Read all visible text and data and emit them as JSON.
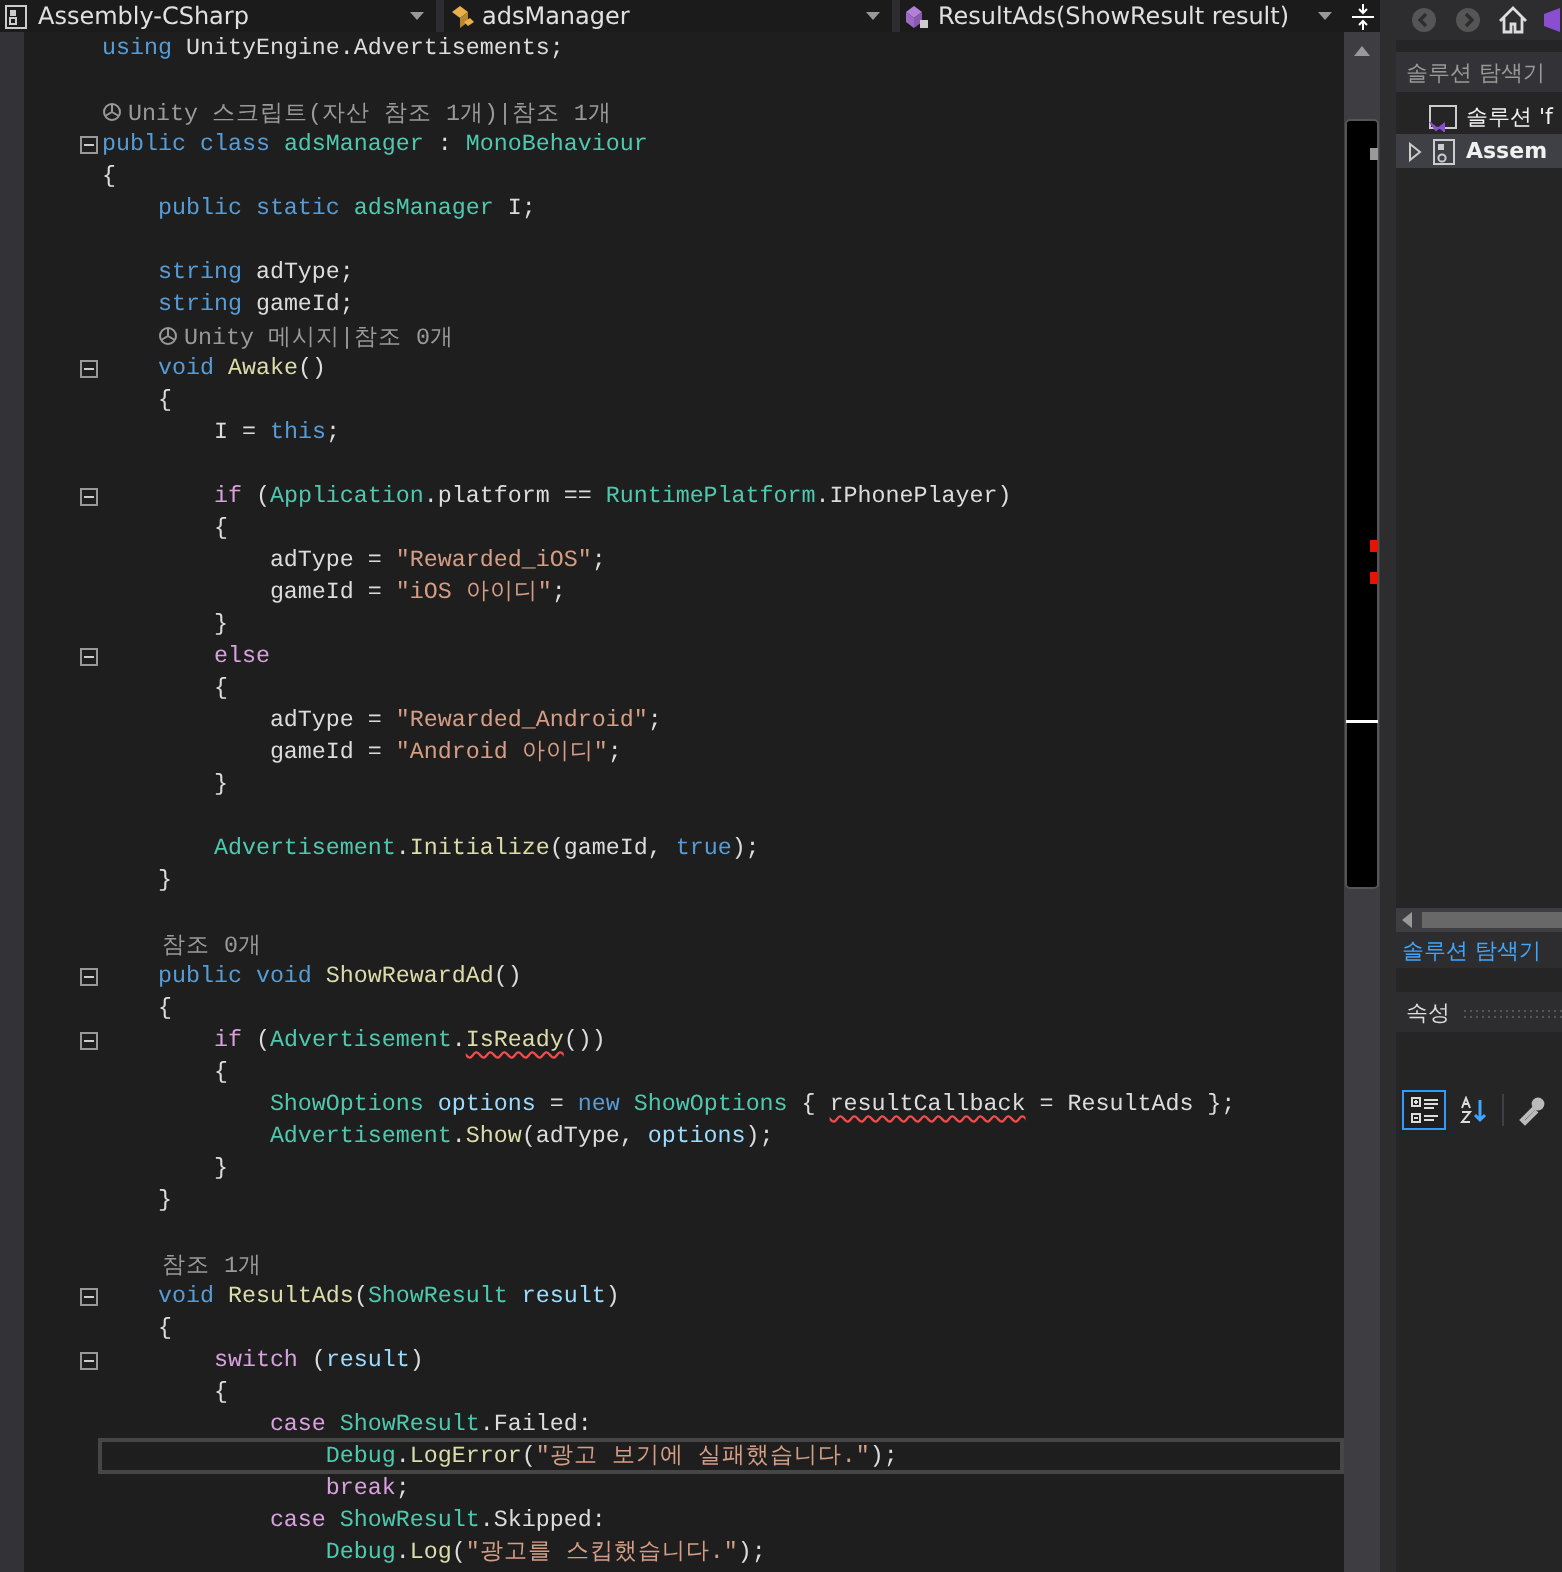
{
  "navigation_bar": {
    "dropdowns": [
      {
        "label": "Assembly-CSharp"
      },
      {
        "label": "adsManager"
      },
      {
        "label": "ResultAds(ShowResult result)"
      }
    ]
  },
  "editor": {
    "lines": [
      {
        "kind": "code",
        "fold": false,
        "current": false,
        "tokens": [
          {
            "text": "using",
            "kind": "kw"
          },
          {
            "text": " UnityEngine.Advertisements;",
            "kind": "plain"
          }
        ]
      },
      {
        "kind": "blank",
        "fold": false,
        "current": false
      },
      {
        "kind": "unitylens",
        "text": "Unity 스크립트(자산 참조 1개)|참조 1개",
        "fold": false,
        "current": false
      },
      {
        "kind": "code",
        "fold": true,
        "current": false,
        "tokens": [
          {
            "text": "public class ",
            "kind": "kw"
          },
          {
            "text": "adsManager",
            "kind": "type"
          },
          {
            "text": " : ",
            "kind": "plain"
          },
          {
            "text": "MonoBehaviour",
            "kind": "type"
          }
        ]
      },
      {
        "kind": "code",
        "fold": false,
        "current": false,
        "tokens": [
          {
            "text": "{",
            "kind": "plain"
          }
        ]
      },
      {
        "kind": "code",
        "fold": false,
        "current": false,
        "tokens": [
          {
            "text": "    public static ",
            "kind": "kw"
          },
          {
            "text": "adsManager",
            "kind": "type"
          },
          {
            "text": " I;",
            "kind": "plain"
          }
        ]
      },
      {
        "kind": "blank",
        "fold": false,
        "current": false
      },
      {
        "kind": "code",
        "fold": false,
        "current": false,
        "tokens": [
          {
            "text": "    string",
            "kind": "kw"
          },
          {
            "text": " adType;",
            "kind": "plain"
          }
        ]
      },
      {
        "kind": "code",
        "fold": false,
        "current": false,
        "tokens": [
          {
            "text": "    string",
            "kind": "kw"
          },
          {
            "text": " gameId;",
            "kind": "plain"
          }
        ]
      },
      {
        "kind": "unitylens",
        "text": "    Unity 메시지|참조 0개",
        "fold": false,
        "current": false
      },
      {
        "kind": "code",
        "fold": true,
        "current": false,
        "tokens": [
          {
            "text": "    void ",
            "kind": "kw"
          },
          {
            "text": "Awake",
            "kind": "method"
          },
          {
            "text": "()",
            "kind": "plain"
          }
        ]
      },
      {
        "kind": "code",
        "fold": false,
        "current": false,
        "tokens": [
          {
            "text": "    {",
            "kind": "plain"
          }
        ]
      },
      {
        "kind": "code",
        "fold": false,
        "current": false,
        "tokens": [
          {
            "text": "        I = ",
            "kind": "plain"
          },
          {
            "text": "this",
            "kind": "kw"
          },
          {
            "text": ";",
            "kind": "plain"
          }
        ]
      },
      {
        "kind": "blank",
        "fold": false,
        "current": false
      },
      {
        "kind": "code",
        "fold": true,
        "current": false,
        "tokens": [
          {
            "text": "        if",
            "kind": "ctl"
          },
          {
            "text": " (",
            "kind": "plain"
          },
          {
            "text": "Application",
            "kind": "type"
          },
          {
            "text": ".platform == ",
            "kind": "plain"
          },
          {
            "text": "RuntimePlatform",
            "kind": "type"
          },
          {
            "text": ".IPhonePlayer)",
            "kind": "plain"
          }
        ]
      },
      {
        "kind": "code",
        "fold": false,
        "current": false,
        "tokens": [
          {
            "text": "        {",
            "kind": "plain"
          }
        ]
      },
      {
        "kind": "code",
        "fold": false,
        "current": false,
        "tokens": [
          {
            "text": "            adType = ",
            "kind": "plain"
          },
          {
            "text": "\"Rewarded_iOS\"",
            "kind": "str"
          },
          {
            "text": ";",
            "kind": "plain"
          }
        ]
      },
      {
        "kind": "code",
        "fold": false,
        "current": false,
        "tokens": [
          {
            "text": "            gameId = ",
            "kind": "plain"
          },
          {
            "text": "\"iOS 아이디\"",
            "kind": "str"
          },
          {
            "text": ";",
            "kind": "plain"
          }
        ]
      },
      {
        "kind": "code",
        "fold": false,
        "current": false,
        "tokens": [
          {
            "text": "        }",
            "kind": "plain"
          }
        ]
      },
      {
        "kind": "code",
        "fold": true,
        "current": false,
        "tokens": [
          {
            "text": "        else",
            "kind": "ctl"
          }
        ]
      },
      {
        "kind": "code",
        "fold": false,
        "current": false,
        "tokens": [
          {
            "text": "        {",
            "kind": "plain"
          }
        ]
      },
      {
        "kind": "code",
        "fold": false,
        "current": false,
        "tokens": [
          {
            "text": "            adType = ",
            "kind": "plain"
          },
          {
            "text": "\"Rewarded_Android\"",
            "kind": "str"
          },
          {
            "text": ";",
            "kind": "plain"
          }
        ]
      },
      {
        "kind": "code",
        "fold": false,
        "current": false,
        "tokens": [
          {
            "text": "            gameId = ",
            "kind": "plain"
          },
          {
            "text": "\"Android 아이디\"",
            "kind": "str"
          },
          {
            "text": ";",
            "kind": "plain"
          }
        ]
      },
      {
        "kind": "code",
        "fold": false,
        "current": false,
        "tokens": [
          {
            "text": "        }",
            "kind": "plain"
          }
        ]
      },
      {
        "kind": "blank",
        "fold": false,
        "current": false
      },
      {
        "kind": "code",
        "fold": false,
        "current": false,
        "tokens": [
          {
            "text": "        Advertisement",
            "kind": "type"
          },
          {
            "text": ".",
            "kind": "plain"
          },
          {
            "text": "Initialize",
            "kind": "method"
          },
          {
            "text": "(gameId, ",
            "kind": "plain"
          },
          {
            "text": "true",
            "kind": "kw"
          },
          {
            "text": ");",
            "kind": "plain"
          }
        ]
      },
      {
        "kind": "code",
        "fold": false,
        "current": false,
        "tokens": [
          {
            "text": "    }",
            "kind": "plain"
          }
        ]
      },
      {
        "kind": "blank",
        "fold": false,
        "current": false
      },
      {
        "kind": "lens",
        "text": "    참조 0개",
        "fold": false,
        "current": false
      },
      {
        "kind": "code",
        "fold": true,
        "current": false,
        "tokens": [
          {
            "text": "    public void ",
            "kind": "kw"
          },
          {
            "text": "ShowRewardAd",
            "kind": "method"
          },
          {
            "text": "()",
            "kind": "plain"
          }
        ]
      },
      {
        "kind": "code",
        "fold": false,
        "current": false,
        "tokens": [
          {
            "text": "    {",
            "kind": "plain"
          }
        ]
      },
      {
        "kind": "code",
        "fold": true,
        "current": false,
        "tokens": [
          {
            "text": "        if",
            "kind": "ctl"
          },
          {
            "text": " (",
            "kind": "plain"
          },
          {
            "text": "Advertisement",
            "kind": "type"
          },
          {
            "text": ".",
            "kind": "plain"
          },
          {
            "text": "IsReady",
            "kind": "method",
            "squiggle": true
          },
          {
            "text": "())",
            "kind": "plain"
          }
        ]
      },
      {
        "kind": "code",
        "fold": false,
        "current": false,
        "tokens": [
          {
            "text": "        {",
            "kind": "plain"
          }
        ]
      },
      {
        "kind": "code",
        "fold": false,
        "current": false,
        "tokens": [
          {
            "text": "            ShowOptions",
            "kind": "type"
          },
          {
            "text": " options",
            "kind": "var"
          },
          {
            "text": " = ",
            "kind": "plain"
          },
          {
            "text": "new",
            "kind": "kw"
          },
          {
            "text": " ShowOptions",
            "kind": "type"
          },
          {
            "text": " { ",
            "kind": "plain"
          },
          {
            "text": "resultCallback",
            "kind": "plain",
            "squiggle": true
          },
          {
            "text": " = ResultAds };",
            "kind": "plain"
          }
        ]
      },
      {
        "kind": "code",
        "fold": false,
        "current": false,
        "tokens": [
          {
            "text": "            Advertisement",
            "kind": "type"
          },
          {
            "text": ".",
            "kind": "plain"
          },
          {
            "text": "Show",
            "kind": "method"
          },
          {
            "text": "(adType, ",
            "kind": "plain"
          },
          {
            "text": "options",
            "kind": "var"
          },
          {
            "text": ");",
            "kind": "plain"
          }
        ]
      },
      {
        "kind": "code",
        "fold": false,
        "current": false,
        "tokens": [
          {
            "text": "        }",
            "kind": "plain"
          }
        ]
      },
      {
        "kind": "code",
        "fold": false,
        "current": false,
        "tokens": [
          {
            "text": "    }",
            "kind": "plain"
          }
        ]
      },
      {
        "kind": "blank",
        "fold": false,
        "current": false
      },
      {
        "kind": "lens",
        "text": "    참조 1개",
        "fold": false,
        "current": false
      },
      {
        "kind": "code",
        "fold": true,
        "current": false,
        "tokens": [
          {
            "text": "    void ",
            "kind": "kw"
          },
          {
            "text": "ResultAds",
            "kind": "method"
          },
          {
            "text": "(",
            "kind": "plain"
          },
          {
            "text": "ShowResult",
            "kind": "type"
          },
          {
            "text": " result",
            "kind": "var"
          },
          {
            "text": ")",
            "kind": "plain"
          }
        ]
      },
      {
        "kind": "code",
        "fold": false,
        "current": false,
        "tokens": [
          {
            "text": "    {",
            "kind": "plain"
          }
        ]
      },
      {
        "kind": "code",
        "fold": true,
        "current": false,
        "tokens": [
          {
            "text": "        switch",
            "kind": "ctl"
          },
          {
            "text": " (",
            "kind": "plain"
          },
          {
            "text": "result",
            "kind": "var"
          },
          {
            "text": ")",
            "kind": "plain"
          }
        ]
      },
      {
        "kind": "code",
        "fold": false,
        "current": false,
        "tokens": [
          {
            "text": "        {",
            "kind": "plain"
          }
        ]
      },
      {
        "kind": "code",
        "fold": false,
        "current": false,
        "tokens": [
          {
            "text": "            case",
            "kind": "ctl"
          },
          {
            "text": " ShowResult",
            "kind": "type"
          },
          {
            "text": ".Failed:",
            "kind": "plain"
          }
        ]
      },
      {
        "kind": "code",
        "fold": false,
        "current": true,
        "tokens": [
          {
            "text": "                Debug",
            "kind": "type"
          },
          {
            "text": ".",
            "kind": "plain"
          },
          {
            "text": "LogError",
            "kind": "method"
          },
          {
            "text": "(",
            "kind": "plain"
          },
          {
            "text": "\"광고 보기에 실패했습니다.\"",
            "kind": "str"
          },
          {
            "text": ");",
            "kind": "plain"
          }
        ]
      },
      {
        "kind": "code",
        "fold": false,
        "current": false,
        "tokens": [
          {
            "text": "                break",
            "kind": "ctl"
          },
          {
            "text": ";",
            "kind": "plain"
          }
        ]
      },
      {
        "kind": "code",
        "fold": false,
        "current": false,
        "tokens": [
          {
            "text": "            case",
            "kind": "ctl"
          },
          {
            "text": " ShowResult",
            "kind": "type"
          },
          {
            "text": ".Skipped:",
            "kind": "plain"
          }
        ]
      },
      {
        "kind": "code",
        "fold": false,
        "current": false,
        "tokens": [
          {
            "text": "                Debug",
            "kind": "type"
          },
          {
            "text": ".",
            "kind": "plain"
          },
          {
            "text": "Log",
            "kind": "method"
          },
          {
            "text": "(",
            "kind": "plain"
          },
          {
            "text": "\"광고를 스킵했습니다.\"",
            "kind": "str"
          },
          {
            "text": ");",
            "kind": "plain"
          }
        ]
      }
    ]
  },
  "solution_explorer": {
    "search": {
      "placeholder": "솔루션 탐색기"
    },
    "tree": [
      {
        "label": "솔루션 'f",
        "selected": false,
        "children": [
          {
            "label": "Assem",
            "selected": true,
            "expanded": false
          }
        ]
      }
    ],
    "tabs": [
      {
        "label": "솔루션 탐색기",
        "selected": true
      }
    ]
  },
  "properties": {
    "title": "속성",
    "toolbar": [
      {
        "selected": true
      },
      {
        "selected": false
      },
      {
        "selected": false
      }
    ]
  }
}
